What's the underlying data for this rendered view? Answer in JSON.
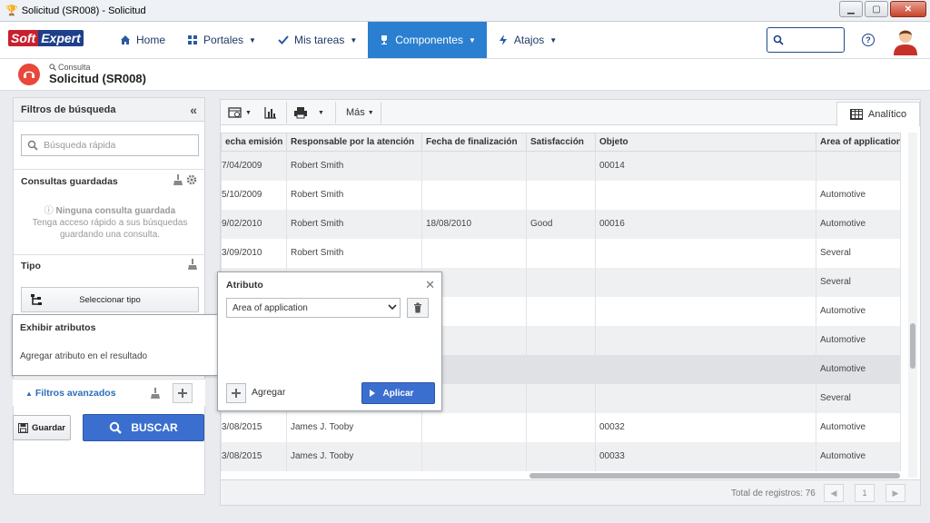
{
  "window": {
    "title": "Solicitud (SR008) - Solicitud",
    "buttons": {
      "minimize": "▁",
      "maximize": "▢",
      "close": "✕"
    }
  },
  "brand": {
    "part1": "Soft",
    "part2": "Expert"
  },
  "nav": {
    "items": [
      {
        "label": "Home",
        "icon": "home-icon"
      },
      {
        "label": "Portales",
        "icon": "grid-icon"
      },
      {
        "label": "Mis tareas",
        "icon": "check-icon"
      },
      {
        "label": "Componentes",
        "icon": "trophy-icon"
      },
      {
        "label": "Atajos",
        "icon": "bolt-icon"
      }
    ],
    "help": "?"
  },
  "page": {
    "breadcrumb": "Consulta",
    "title": "Solicitud (SR008)"
  },
  "filters": {
    "header": "Filtros de búsqueda",
    "collapse": "«",
    "search_placeholder": "Búsqueda rápida",
    "saved_title": "Consultas guardadas",
    "saved_empty_title": "Ninguna consulta guardada",
    "saved_empty_text": "Tenga acceso rápido a sus búsquedas guardando una consulta.",
    "type_title": "Tipo",
    "select_type": "Seleccionar tipo",
    "advanced": "Filtros avanzados",
    "advanced_caret": "▲",
    "save": "Guardar",
    "search": "BUSCAR"
  },
  "toolbar": {
    "more": "Más",
    "tab": "Analítico"
  },
  "grid": {
    "columns": [
      "echa emisión",
      "Responsable por la atención",
      "Fecha de finalización",
      "Satisfacción",
      "Objeto",
      "Area of application"
    ],
    "rows": [
      [
        "7/04/2009",
        "Robert Smith",
        "",
        "",
        "00014",
        ""
      ],
      [
        "5/10/2009",
        "Robert Smith",
        "",
        "",
        "",
        "Automotive"
      ],
      [
        "9/02/2010",
        "Robert Smith",
        "18/08/2010",
        "Good",
        "00016",
        "Automotive"
      ],
      [
        "3/09/2010",
        "Robert Smith",
        "",
        "",
        "",
        "Several"
      ],
      [
        "",
        "",
        "",
        "",
        "",
        "Several"
      ],
      [
        "",
        "",
        "",
        "",
        "",
        "Automotive"
      ],
      [
        "",
        "",
        "",
        "",
        "",
        "Automotive"
      ],
      [
        "",
        "",
        "",
        "",
        "",
        "Automotive"
      ],
      [
        "",
        "",
        "",
        "",
        "",
        "Several"
      ],
      [
        "3/08/2015",
        "James J. Tooby",
        "",
        "",
        "00032",
        "Automotive"
      ],
      [
        "3/08/2015",
        "James J. Tooby",
        "",
        "",
        "00033",
        "Automotive"
      ]
    ],
    "total": "Total de registros: 76",
    "page": "1",
    "pager": {
      "first": "◀",
      "prev": "",
      "last": "▶"
    }
  },
  "popup": {
    "title": "Atributo",
    "close": "✕",
    "selected": "Area of application",
    "add": "Agregar",
    "apply": "Aplicar"
  },
  "attributes": {
    "title": "Exhibir atributos",
    "link": "Agregar atributo en el resultado"
  }
}
